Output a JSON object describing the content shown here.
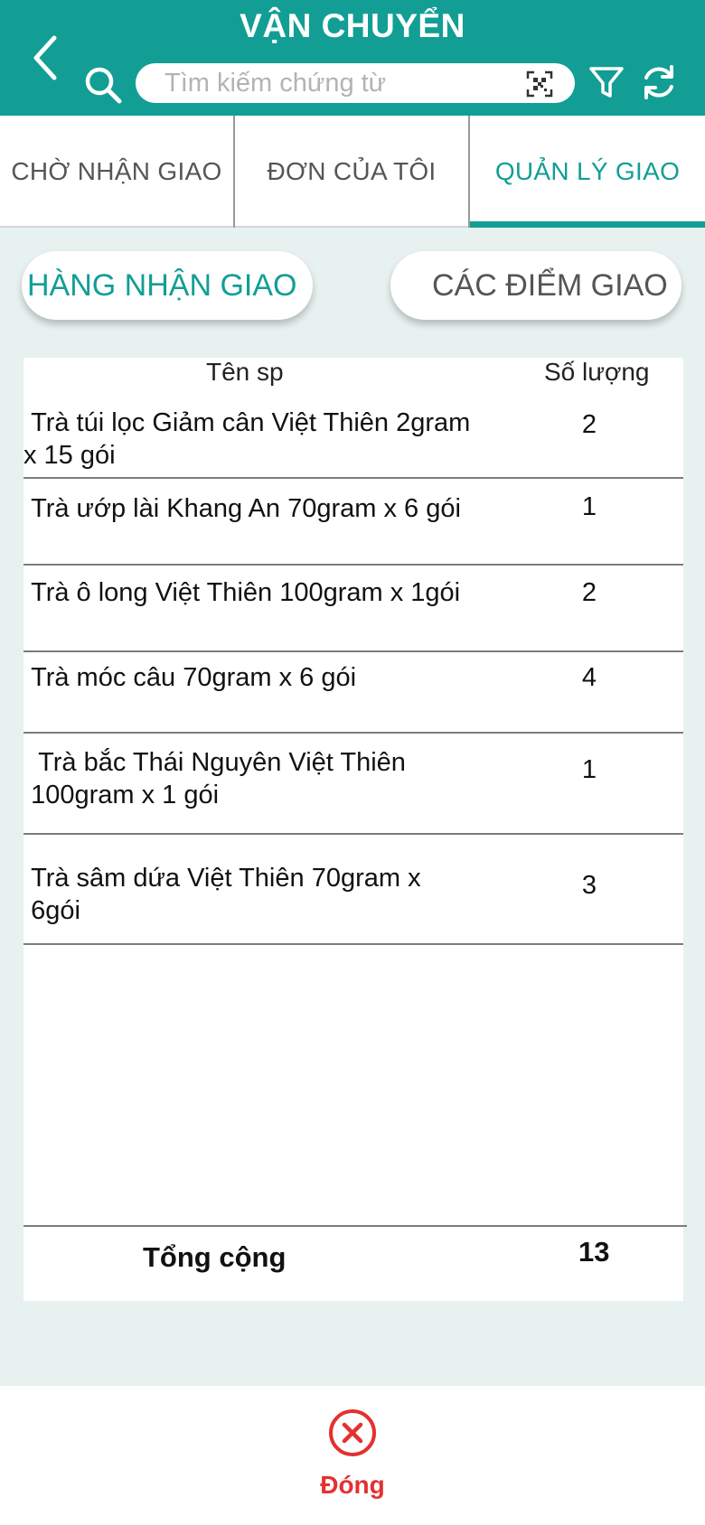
{
  "header": {
    "title": "VẬN CHUYỂN",
    "search_placeholder": "Tìm kiếm chứng từ"
  },
  "tabs": [
    {
      "label": "CHỜ NHẬN GIAO",
      "active": false
    },
    {
      "label": "ĐƠN CỦA TÔI",
      "active": false
    },
    {
      "label": "QUẢN LÝ GIAO",
      "active": true
    }
  ],
  "segments": [
    {
      "label": "HÀNG NHẬN GIAO",
      "active": true
    },
    {
      "label": "CÁC ĐIỂM GIAO",
      "active": false
    }
  ],
  "table": {
    "col_name": "Tên sp",
    "col_qty": "Số lượng",
    "rows": [
      {
        "name": " Trà túi lọc Giảm cân Việt Thiên 2gram\nx 15 gói",
        "qty": "2"
      },
      {
        "name": " Trà ướp lài Khang An 70gram x 6 gói",
        "qty": "1"
      },
      {
        "name": " Trà ô long Việt Thiên 100gram x 1gói",
        "qty": "2"
      },
      {
        "name": " Trà móc câu 70gram x 6 gói",
        "qty": "4"
      },
      {
        "name": "  Trà bắc Thái Nguyên Việt Thiên\n 100gram x 1 gói",
        "qty": "1"
      },
      {
        "name": " Trà sâm dứa Việt Thiên 70gram x\n 6gói",
        "qty": "3"
      }
    ],
    "total_label": "Tổng cộng",
    "total_value": "13"
  },
  "footer": {
    "close_label": "Đóng"
  },
  "colors": {
    "accent": "#129e95",
    "close": "#e53030",
    "background": "#e7f1ef"
  }
}
